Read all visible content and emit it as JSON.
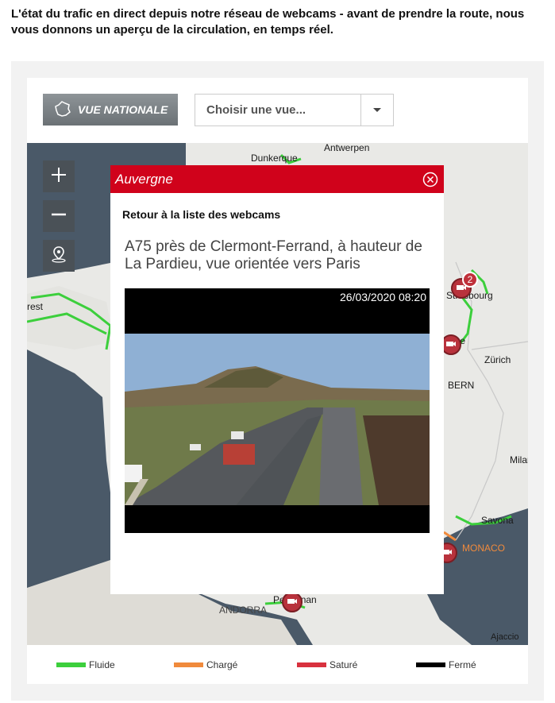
{
  "intro": {
    "text": "L'état du trafic en direct depuis notre réseau de webcams  -  avant de prendre la route, nous vous donnons un aperçu de la circulation, en temps réel."
  },
  "toolbar": {
    "vue_nationale_label": "VUE NATIONALE",
    "select": {
      "value": "Choisir une vue..."
    }
  },
  "map": {
    "labels": [
      "Dunkerque",
      "Antwerpen",
      "Strasbourg",
      "Mulhouse",
      "Zürich",
      "BERN",
      "Milano",
      "Savona",
      "MONACO",
      "Perpignan",
      "ANDORRA",
      "Ajaccio",
      "Brest"
    ],
    "cluster_badge": "2",
    "colors": {
      "fluide": "#3ccf3c",
      "charge": "#f08a3c",
      "sature": "#d8313e",
      "ferme": "#000000",
      "camera": "#b8323c"
    },
    "icons": {
      "zoom_in": "plus-icon",
      "zoom_out": "minus-icon",
      "locate": "location-pin-icon",
      "camera": "camera-icon"
    }
  },
  "legend": [
    {
      "label": "Fluide",
      "color": "#3ccf3c"
    },
    {
      "label": "Chargé",
      "color": "#f08a3c"
    },
    {
      "label": "Saturé",
      "color": "#d8313e"
    },
    {
      "label": "Fermé",
      "color": "#000000"
    }
  ],
  "popup": {
    "region": "Auvergne",
    "back_label": "Retour à la liste des webcams",
    "camera_title": "A75 près de Clermont-Ferrand, à hauteur de La Pardieu, vue orientée vers Paris",
    "timestamp": "26/03/2020 08:20"
  }
}
